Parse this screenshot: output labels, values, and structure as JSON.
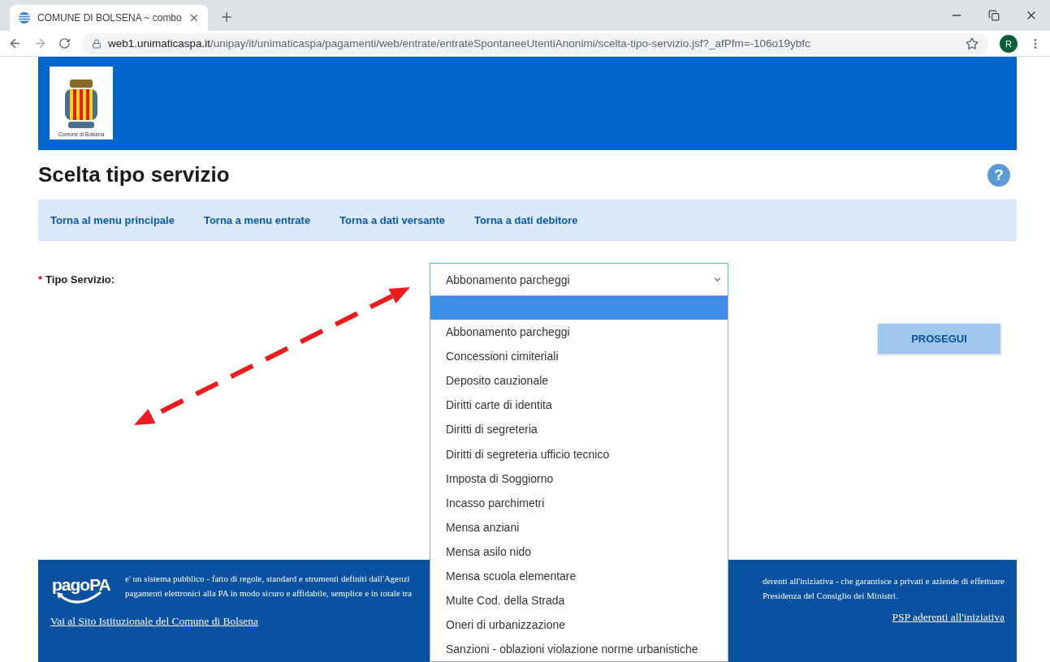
{
  "browser": {
    "tab_title": "COMUNE DI BOLSENA ~ combo",
    "url_host": "web1.unimaticaspa.it",
    "url_path": "/unipay/it/unimaticaspa/pagamenti/web/entrate/entrateSpontaneeUtentiAnonimi/scelta-tipo-servizio.jsf?_afPfm=-106o19ybfc",
    "profile_initial": "R"
  },
  "header": {
    "logo_caption": "Comune di Bolsena"
  },
  "page_title": "Scelta tipo servizio",
  "help_symbol": "?",
  "nav_links": [
    "Torna al menu principale",
    "Torna a menu entrate",
    "Torna a dati versante",
    "Torna a dati debitore"
  ],
  "form": {
    "required_mark": "*",
    "label": "Tipo Servizio:",
    "value": "Abbonamento parcheggi",
    "submit": "PROSEGUI"
  },
  "dropdown": {
    "blank_option_highlighted": true,
    "options": [
      {
        "label": "Abbonamento parcheggi",
        "selected": false
      },
      {
        "label": "Concessioni cimiteriali",
        "selected": false
      },
      {
        "label": "Deposito cauzionale",
        "selected": false
      },
      {
        "label": "Diritti carte di identita",
        "selected": false
      },
      {
        "label": "Diritti di segreteria",
        "selected": false
      },
      {
        "label": "Diritti di segreteria ufficio tecnico",
        "selected": false
      },
      {
        "label": "Imposta di Soggiorno",
        "selected": false
      },
      {
        "label": "Incasso parchimetri",
        "selected": false
      },
      {
        "label": "Mensa anziani",
        "selected": false
      },
      {
        "label": "Mensa asilo nido",
        "selected": false
      },
      {
        "label": "Mensa scuola elementare",
        "selected": false
      },
      {
        "label": "Multe Cod. della Strada",
        "selected": false
      },
      {
        "label": "Oneri di urbanizzazione",
        "selected": false
      },
      {
        "label": "Sanzioni - oblazioni violazione norme urbanistiche",
        "selected": false
      }
    ]
  },
  "footer": {
    "logo_text": "pagoPA",
    "text_left": [
      "e' un sistema pubblico - fatto di regole, standard e strumenti definiti dall'Agenzi",
      "pagamenti elettronici alla PA in modo sicuro e affidabile, semplice e in totale tra"
    ],
    "text_right": [
      "derenti all'iniziativa - che garantisce a privati e aziende di effettuare",
      "Presidenza del Consiglio dei Ministri."
    ],
    "link_left": "Vai al Sito Istituzionale del Comune di Bolsena",
    "link_right": "PSP aderenti all'iniziativa"
  }
}
